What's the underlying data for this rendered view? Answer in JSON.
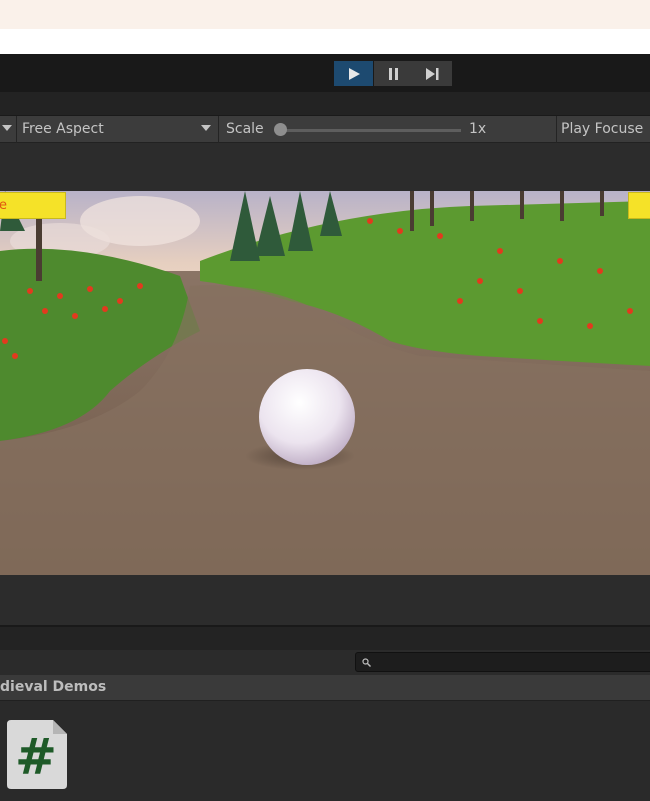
{
  "toolbar": {
    "aspect_label": "Free Aspect",
    "scale_label": "Scale",
    "scale_value": "1x",
    "scale_level": 0.0,
    "play_focus_label": "Play Focuse",
    "play_state": "playing"
  },
  "game_overlay": {
    "left_button_label": "e",
    "right_button_label": ""
  },
  "project": {
    "breadcrumb": "dieval Demos",
    "search_value": "",
    "assets": [
      {
        "icon": "csharp-script-icon",
        "glyph": "#"
      }
    ]
  },
  "colors": {
    "play_active": "#1d4a70",
    "overlay_button": "#f5e228",
    "script_glyph": "#1e5a28"
  }
}
